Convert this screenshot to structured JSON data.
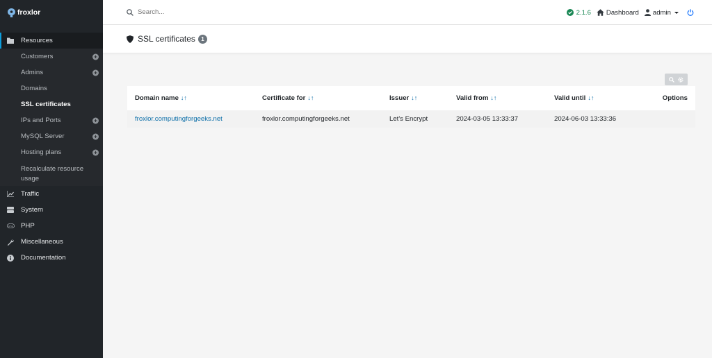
{
  "brand": {
    "name": "froxlor"
  },
  "sidebar": {
    "resources_label": "Resources",
    "resources_items": [
      {
        "label": "Customers",
        "expandable": true
      },
      {
        "label": "Admins",
        "expandable": true
      },
      {
        "label": "Domains",
        "expandable": false
      },
      {
        "label": "SSL certificates",
        "expandable": false,
        "current": true
      },
      {
        "label": "IPs and Ports",
        "expandable": true
      },
      {
        "label": "MySQL Server",
        "expandable": true
      },
      {
        "label": "Hosting plans",
        "expandable": true
      },
      {
        "label": "Recalculate resource usage",
        "expandable": false
      }
    ],
    "sections": [
      {
        "label": "Traffic",
        "icon": "chart-icon"
      },
      {
        "label": "System",
        "icon": "server-icon"
      },
      {
        "label": "PHP",
        "icon": "php-icon"
      },
      {
        "label": "Miscellaneous",
        "icon": "wrench-icon"
      },
      {
        "label": "Documentation",
        "icon": "info-icon"
      }
    ]
  },
  "topbar": {
    "search_placeholder": "Search...",
    "version": "2.1.6",
    "dashboard_label": "Dashboard",
    "user_label": "admin"
  },
  "page": {
    "title": "SSL certificates",
    "count": "1"
  },
  "table": {
    "sort_glyph": "↓↑",
    "headers": {
      "domain": "Domain name",
      "certificate_for": "Certificate for",
      "issuer": "Issuer",
      "valid_from": "Valid from",
      "valid_until": "Valid until",
      "options": "Options"
    },
    "rows": [
      {
        "domain": "froxlor.computingforgeeks.net",
        "certificate_for": "froxlor.computingforgeeks.net",
        "issuer": "Let's Encrypt",
        "valid_from": "2024-03-05 13:33:37",
        "valid_until": "2024-06-03 13:33:36",
        "options": ""
      }
    ]
  },
  "colors": {
    "sidebar_bg": "#212529",
    "accent": "#0d9ddb",
    "link": "#0b6ea8",
    "version_green": "#198754",
    "power_blue": "#0d6efd"
  }
}
